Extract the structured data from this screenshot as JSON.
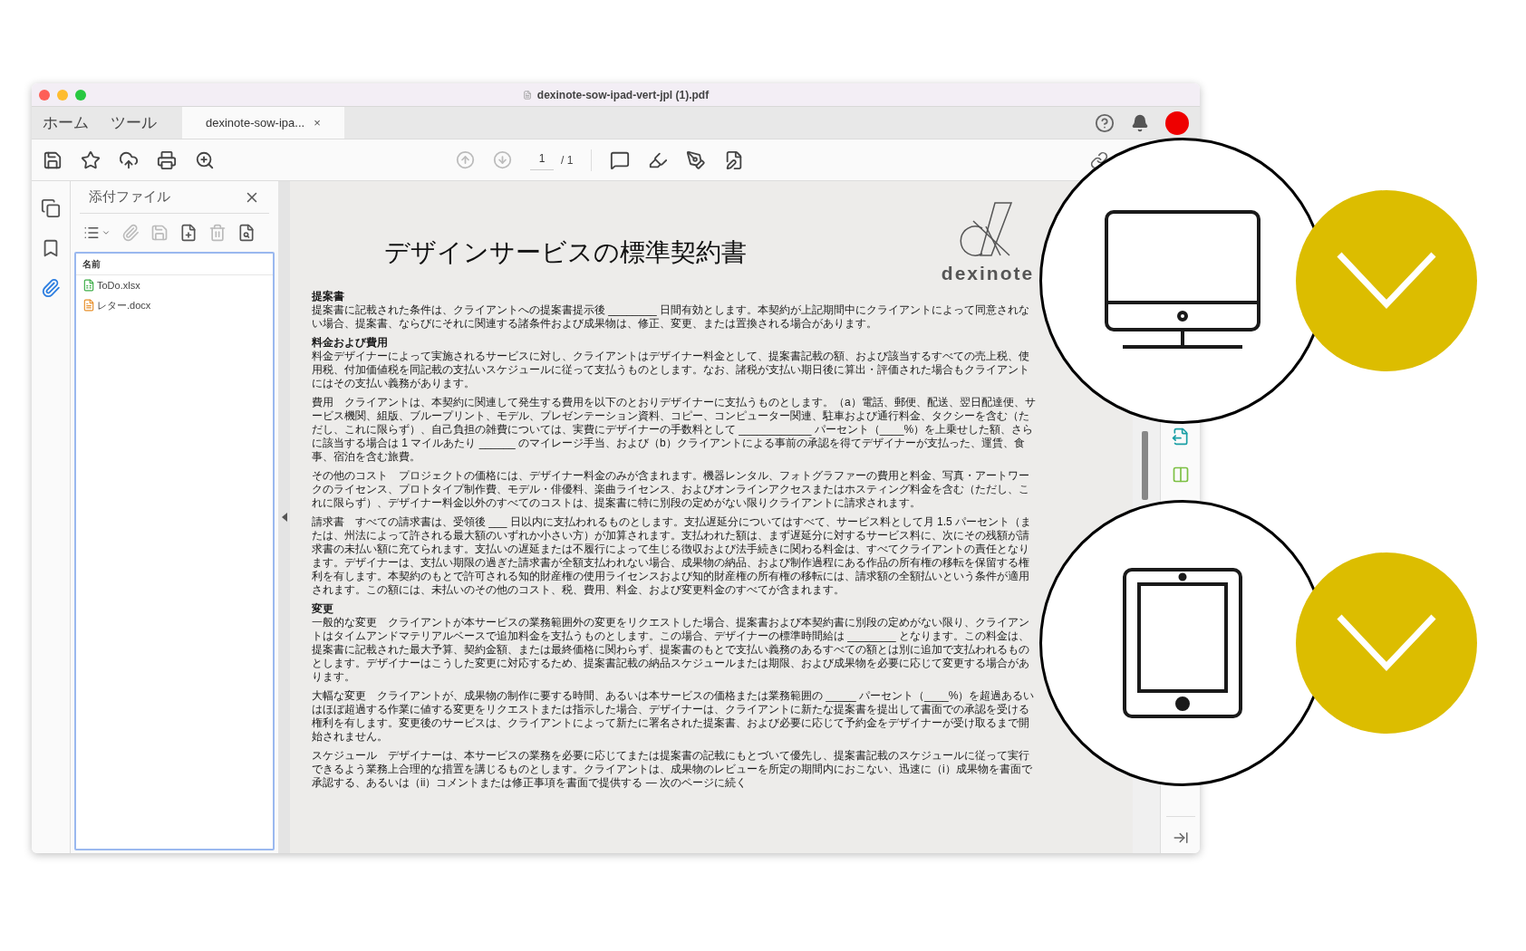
{
  "window": {
    "title": "dexinote-sow-ipad-vert-jpl (1).pdf"
  },
  "nav_tabs": [
    {
      "label": "ホーム",
      "selected": false
    },
    {
      "label": "ツール",
      "selected": false
    },
    {
      "label": "dexinote-sow-ipa...",
      "selected": true,
      "close": "×"
    }
  ],
  "page_nav": {
    "current": "1",
    "total": "/ 1"
  },
  "rail_items": [
    {
      "kind": "pages",
      "selected": false
    },
    {
      "kind": "bookmarks",
      "selected": false
    },
    {
      "kind": "attachments",
      "selected": true
    }
  ],
  "attachments": {
    "title": "添付ファイル",
    "column": "名前",
    "files": [
      {
        "name": "ToDo.xlsx",
        "kind": "xlsx"
      },
      {
        "name": "レター.docx",
        "kind": "docx"
      }
    ]
  },
  "document": {
    "title": "デザインサービスの標準契約書",
    "logo_text": "dexinote",
    "blocks": [
      {
        "kind": "heading",
        "text": "提案書"
      },
      {
        "kind": "paragraph",
        "text": "提案書に記載された条件は、クライアントへの提案書提示後 ________ 日間有効とします。本契約が上記期間中にクライアントによって同意されない場合、提案書、ならびにそれに関連する諸条件および成果物は、修正、変更、または置換される場合があります。"
      },
      {
        "kind": "heading",
        "text": "料金および費用"
      },
      {
        "kind": "paragraph",
        "text": "料金デザイナーによって実施されるサービスに対し、クライアントはデザイナー料金として、提案書記載の額、および該当するすべての売上税、使用税、付加価値税を同記載の支払いスケジュールに従って支払うものとします。なお、諸税が支払い期日後に算出・評価された場合もクライアントにはその支払い義務があります。"
      },
      {
        "kind": "paragraph",
        "text": "費用　クライアントは、本契約に関連して発生する費用を以下のとおりデザイナーに支払うものとします。（a）電話、郵便、配送、翌日配達便、サービス機関、組版、ブループリント、モデル、プレゼンテーション資料、コピー、コンピューター関連、駐車および通行料金、タクシーを含む（ただし、これに限らず）、自己負担の雑費については、実費にデザイナーの手数料として ____________ パーセント（____%）を上乗せした額、さらに該当する場合は 1 マイルあたり ______ のマイレージ手当、および（b）クライアントによる事前の承認を得てデザイナーが支払った、運賃、食事、宿泊を含む旅費。"
      },
      {
        "kind": "paragraph",
        "text": "その他のコスト　プロジェクトの価格には、デザイナー料金のみが含まれます。機器レンタル、フォトグラファーの費用と料金、写真・アートワークのライセンス、プロトタイプ制作費、モデル・俳優料、楽曲ライセンス、およびオンラインアクセスまたはホスティング料金を含む（ただし、これに限らず）、デザイナー料金以外のすべてのコストは、提案書に特に別段の定めがない限りクライアントに請求されます。"
      },
      {
        "kind": "paragraph",
        "text": "請求書　すべての請求書は、受領後 ___ 日以内に支払われるものとします。支払遅延分についてはすべて、サービス料として月 1.5 パーセント（または、州法によって許される最大額のいずれか小さい方）が加算されます。支払われた額は、まず遅延分に対するサービス料に、次にその残額が請求書の未払い額に充てられます。支払いの遅延または不履行によって生じる徴収および法手続きに関わる料金は、すべてクライアントの責任となります。デザイナーは、支払い期限の過ぎた請求書が全額支払われない場合、成果物の納品、および制作過程にある作品の所有権の移転を保留する権利を有します。本契約のもとで許可される知的財産権の使用ライセンスおよび知的財産権の所有権の移転には、請求額の全額払いという条件が適用されます。この額には、未払いのその他のコスト、税、費用、料金、および変更料金のすべてが含まれます。"
      },
      {
        "kind": "heading",
        "text": "変更"
      },
      {
        "kind": "paragraph",
        "text": "一般的な変更　クライアントが本サービスの業務範囲外の変更をリクエストした場合、提案書および本契約書に別段の定めがない限り、クライアントはタイムアンドマテリアルベースで追加料金を支払うものとします。この場合、デザイナーの標準時間給は ________ となります。この料金は、提案書に記載された最大予算、契約金額、または最終価格に関わらず、提案書のもとで支払い義務のあるすべての額とは別に追加で支払われるものとします。デザイナーはこうした変更に対応するため、提案書記載の納品スケジュールまたは期限、および成果物を必要に応じて変更する場合があります。"
      },
      {
        "kind": "paragraph",
        "text": "大幅な変更　クライアントが、成果物の制作に要する時間、あるいは本サービスの価格または業務範囲の _____ パーセント（____%）を超過あるいはほぼ超過する作業に値する変更をリクエストまたは指示した場合、デザイナーは、クライアントに新たな提案書を提出して書面での承認を受ける権利を有します。変更後のサービスは、クライアントによって新たに署名された提案書、および必要に応じて予約金をデザイナーが受け取るまで開始されません。"
      },
      {
        "kind": "paragraph",
        "text": "スケジュール　デザイナーは、本サービスの業務を必要に応じてまたは提案書の記載にもとづいて優先し、提案書記載のスケジュールに従って実行できるよう業務上合理的な措置を講じるものとします。クライアントは、成果物のレビューを所定の期間内におこない、迅速に（i）成果物を書面で承認する、あるいは（ii）コメントまたは修正事項を書面で提供する — 次のページに続く"
      }
    ]
  },
  "devices": [
    {
      "kind": "monitor",
      "checked": true
    },
    {
      "kind": "tablet",
      "checked": true
    }
  ]
}
